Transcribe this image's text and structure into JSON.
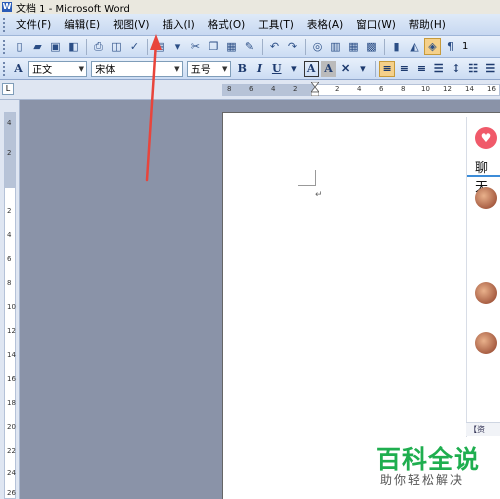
{
  "window": {
    "title": "文档 1 - Microsoft Word"
  },
  "menubar": {
    "items": [
      "文件(F)",
      "编辑(E)",
      "视图(V)",
      "插入(I)",
      "格式(O)",
      "工具(T)",
      "表格(A)",
      "窗口(W)",
      "帮助(H)"
    ]
  },
  "toolbar": {
    "zoom_partial": "1"
  },
  "format_toolbar": {
    "style": "正文",
    "font": "宋体",
    "size": "五号",
    "buttons": [
      "B",
      "I",
      "U",
      "A",
      "A"
    ]
  },
  "ruler": {
    "corner": "L",
    "h_ticks": [
      "8",
      "6",
      "4",
      "2",
      "2",
      "4",
      "6",
      "8",
      "10",
      "12",
      "14",
      "16"
    ],
    "v_ticks": [
      "4",
      "2",
      "2",
      "4",
      "6",
      "8",
      "10",
      "12",
      "14",
      "16",
      "18",
      "20",
      "22",
      "24",
      "26"
    ]
  },
  "document": {
    "paragraph_mark": "↵"
  },
  "chat_panel": {
    "title": "聊天",
    "footer": "【资"
  },
  "watermark": {
    "brand": "百科全说",
    "slogan": "助你轻松解决"
  },
  "colors": {
    "arrow": "#e8453c",
    "brand": "#1fae4f",
    "workspace": "#8a93a8"
  }
}
